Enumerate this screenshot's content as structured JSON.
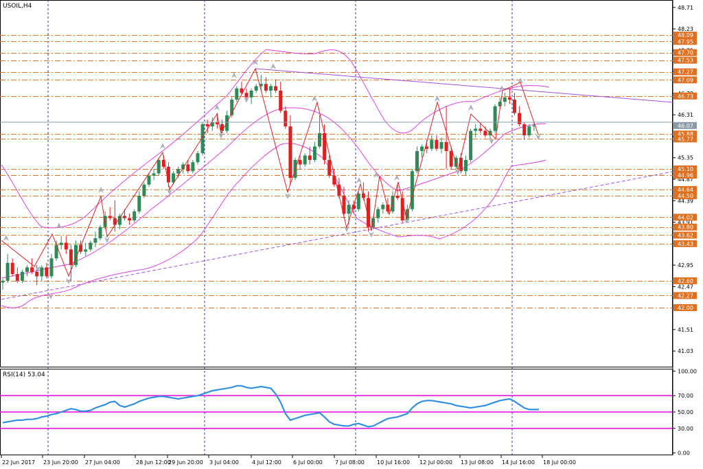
{
  "header": {
    "symbol_title": "USOIL,H4"
  },
  "rsi_panel": {
    "title": "RSI(14) 53.04",
    "levels": [
      30,
      50,
      70
    ]
  },
  "colors": {
    "bull": "#2e8b57",
    "bear": "#e02020",
    "bands": "#e040e0",
    "levels": "#e07020",
    "trend": "#a050e0",
    "zigzag": "#e02020",
    "rsi": "#2f8fe0",
    "rsi_levels": "#e000e0",
    "separator": "#3030c0"
  },
  "chart_data": {
    "type": "candlestick",
    "instrument": "USOIL",
    "timeframe": "H4",
    "price_axis": {
      "ticks": [
        "48.71",
        "48.23",
        "47.75",
        "47.27",
        "46.79",
        "46.31",
        "45.83",
        "45.35",
        "44.87",
        "44.39",
        "43.91",
        "43.43",
        "42.95",
        "42.47",
        "41.99",
        "41.51",
        "41.03"
      ],
      "ylim": [
        40.68,
        48.86
      ]
    },
    "time_axis": {
      "labels": [
        "22 Jun 2017",
        "23 Jun 20:00",
        "27 Jun 04:00",
        "28 Jun 12:00",
        "29 Jun 20:00",
        "3 Jul 04:00",
        "4 Jul 12:00",
        "6 Jul 00:00",
        "7 Jul 08:00",
        "10 Jul 16:00",
        "12 Jul 00:00",
        "13 Jul 08:00",
        "14 Jul 16:00",
        "18 Jul 00:00"
      ]
    },
    "current_price": 46.07,
    "horizontal_levels": [
      "48.09",
      "47.95",
      "47.70",
      "47.53",
      "47.27",
      "47.09",
      "46.73",
      "45.88",
      "45.77",
      "45.10",
      "44.96",
      "44.64",
      "44.50",
      "44.02",
      "43.80",
      "43.62",
      "43.43",
      "42.60",
      "42.27",
      "42.00"
    ],
    "candles": [
      [
        42.56,
        42.64,
        42.4,
        42.6
      ],
      [
        42.6,
        43.2,
        42.55,
        43.0
      ],
      [
        43.0,
        43.1,
        42.7,
        42.75
      ],
      [
        42.75,
        42.9,
        42.55,
        42.6
      ],
      [
        42.6,
        42.85,
        42.55,
        42.8
      ],
      [
        42.8,
        42.95,
        42.7,
        42.9
      ],
      [
        42.9,
        43.1,
        42.75,
        42.8
      ],
      [
        42.8,
        42.95,
        42.5,
        42.7
      ],
      [
        42.7,
        42.95,
        42.6,
        42.9
      ],
      [
        42.9,
        43.0,
        42.65,
        42.7
      ],
      [
        42.7,
        43.2,
        42.65,
        43.1
      ],
      [
        43.1,
        43.5,
        43.05,
        43.4
      ],
      [
        43.4,
        43.6,
        43.3,
        43.45
      ],
      [
        43.45,
        43.6,
        43.2,
        43.3
      ],
      [
        43.3,
        43.4,
        42.6,
        42.95
      ],
      [
        42.95,
        43.5,
        42.9,
        43.4
      ],
      [
        43.4,
        43.5,
        43.2,
        43.25
      ],
      [
        43.25,
        43.45,
        43.15,
        43.3
      ],
      [
        43.3,
        43.5,
        43.25,
        43.45
      ],
      [
        43.45,
        43.7,
        43.35,
        43.55
      ],
      [
        43.55,
        43.85,
        43.5,
        43.8
      ],
      [
        43.8,
        44.15,
        43.75,
        44.05
      ],
      [
        44.05,
        44.25,
        43.95,
        44.0
      ],
      [
        44.0,
        44.4,
        43.7,
        43.85
      ],
      [
        43.85,
        44.1,
        43.75,
        44.05
      ],
      [
        44.05,
        44.2,
        43.95,
        44.0
      ],
      [
        44.0,
        44.1,
        43.85,
        43.95
      ],
      [
        43.95,
        44.2,
        43.9,
        44.15
      ],
      [
        44.15,
        44.6,
        44.1,
        44.5
      ],
      [
        44.5,
        44.8,
        44.45,
        44.75
      ],
      [
        44.75,
        45.0,
        44.7,
        44.95
      ],
      [
        44.95,
        45.1,
        44.85,
        45.0
      ],
      [
        45.0,
        45.35,
        44.95,
        45.3
      ],
      [
        45.3,
        45.4,
        45.1,
        45.15
      ],
      [
        45.15,
        45.25,
        44.7,
        44.8
      ],
      [
        44.8,
        45.05,
        44.75,
        45.0
      ],
      [
        45.0,
        45.15,
        44.9,
        45.1
      ],
      [
        45.1,
        45.25,
        45.0,
        45.2
      ],
      [
        45.2,
        45.3,
        45.0,
        45.05
      ],
      [
        45.05,
        45.3,
        45.0,
        45.25
      ],
      [
        45.25,
        45.5,
        45.2,
        45.45
      ],
      [
        45.45,
        46.15,
        45.4,
        46.1
      ],
      [
        46.1,
        46.2,
        45.9,
        46.05
      ],
      [
        46.05,
        46.25,
        45.95,
        46.15
      ],
      [
        46.15,
        46.35,
        46.0,
        46.1
      ],
      [
        46.1,
        46.2,
        45.9,
        45.95
      ],
      [
        45.95,
        46.4,
        45.9,
        46.3
      ],
      [
        46.3,
        46.7,
        46.25,
        46.65
      ],
      [
        46.65,
        46.95,
        46.6,
        46.9
      ],
      [
        46.9,
        47.05,
        46.75,
        46.8
      ],
      [
        46.8,
        46.9,
        46.6,
        46.7
      ],
      [
        46.7,
        46.9,
        46.55,
        46.85
      ],
      [
        46.85,
        47.0,
        46.8,
        46.95
      ],
      [
        46.95,
        47.2,
        46.85,
        47.0
      ],
      [
        47.0,
        47.15,
        46.8,
        46.85
      ],
      [
        46.85,
        47.0,
        46.7,
        46.95
      ],
      [
        46.95,
        47.1,
        46.8,
        46.85
      ],
      [
        46.85,
        47.05,
        46.35,
        46.4
      ],
      [
        46.4,
        46.5,
        46.0,
        46.05
      ],
      [
        46.05,
        46.3,
        44.75,
        44.9
      ],
      [
        44.9,
        45.35,
        44.85,
        45.3
      ],
      [
        45.3,
        45.4,
        45.1,
        45.2
      ],
      [
        45.2,
        45.45,
        45.15,
        45.4
      ],
      [
        45.4,
        45.6,
        45.2,
        45.3
      ],
      [
        45.3,
        45.7,
        45.25,
        45.6
      ],
      [
        45.6,
        46.3,
        45.55,
        45.9
      ],
      [
        45.9,
        46.1,
        45.2,
        45.3
      ],
      [
        45.3,
        45.4,
        44.9,
        44.95
      ],
      [
        44.95,
        45.1,
        44.7,
        44.75
      ],
      [
        44.75,
        44.9,
        44.45,
        44.5
      ],
      [
        44.5,
        44.7,
        44.0,
        44.1
      ],
      [
        44.1,
        44.4,
        43.85,
        44.3
      ],
      [
        44.3,
        44.4,
        44.1,
        44.2
      ],
      [
        44.2,
        44.6,
        44.15,
        44.55
      ],
      [
        44.55,
        44.8,
        44.4,
        44.45
      ],
      [
        44.45,
        44.6,
        43.7,
        43.8
      ],
      [
        43.8,
        44.05,
        43.75,
        44.0
      ],
      [
        44.0,
        44.25,
        43.9,
        44.2
      ],
      [
        44.2,
        44.35,
        44.1,
        44.3
      ],
      [
        44.3,
        44.45,
        44.1,
        44.15
      ],
      [
        44.15,
        44.6,
        44.1,
        44.5
      ],
      [
        44.5,
        44.75,
        44.4,
        44.45
      ],
      [
        44.45,
        44.6,
        43.9,
        43.95
      ],
      [
        43.95,
        44.3,
        43.9,
        44.2
      ],
      [
        44.2,
        45.1,
        44.15,
        45.05
      ],
      [
        45.05,
        45.6,
        45.0,
        45.5
      ],
      [
        45.5,
        45.65,
        45.35,
        45.6
      ],
      [
        45.6,
        45.75,
        45.45,
        45.55
      ],
      [
        45.55,
        45.85,
        45.5,
        45.75
      ],
      [
        45.75,
        45.85,
        45.5,
        45.55
      ],
      [
        45.55,
        45.8,
        45.45,
        45.7
      ],
      [
        45.7,
        46.5,
        45.1,
        45.5
      ],
      [
        45.5,
        45.6,
        45.1,
        45.15
      ],
      [
        45.15,
        45.4,
        45.05,
        45.35
      ],
      [
        45.35,
        45.45,
        45.0,
        45.05
      ],
      [
        45.05,
        45.4,
        44.95,
        45.3
      ],
      [
        45.3,
        46.0,
        45.25,
        45.95
      ],
      [
        45.95,
        46.1,
        45.8,
        46.0
      ],
      [
        46.0,
        46.15,
        45.9,
        45.95
      ],
      [
        45.95,
        46.05,
        45.8,
        45.85
      ],
      [
        45.85,
        46.0,
        45.75,
        45.95
      ],
      [
        45.95,
        46.55,
        45.9,
        46.5
      ],
      [
        46.5,
        46.7,
        46.45,
        46.6
      ],
      [
        46.6,
        46.8,
        46.5,
        46.7
      ],
      [
        46.7,
        46.9,
        46.55,
        46.65
      ],
      [
        46.65,
        46.8,
        46.3,
        46.35
      ],
      [
        46.35,
        46.5,
        46.05,
        46.1
      ],
      [
        46.1,
        46.15,
        45.75,
        45.85
      ],
      [
        45.85,
        46.1,
        45.8,
        46.05
      ],
      [
        46.05,
        46.15,
        45.95,
        46.07
      ]
    ],
    "rsi": {
      "value": 53.04,
      "ylim": [
        -2,
        102
      ],
      "ticks": [
        "100.00",
        "70.00",
        "50.00",
        "30.00",
        "0.00"
      ],
      "values": [
        37,
        38,
        39,
        40,
        40,
        41,
        41,
        42,
        44,
        45,
        47,
        48,
        50,
        52,
        54,
        53,
        51,
        51,
        52,
        55,
        57,
        59,
        62,
        63,
        58,
        56,
        58,
        60,
        63,
        65,
        67,
        68,
        69,
        69,
        68,
        67,
        66,
        67,
        68,
        69,
        70,
        72,
        74,
        76,
        77,
        78,
        79,
        80,
        82,
        82,
        80,
        79,
        80,
        81,
        80,
        79,
        72,
        62,
        48,
        40,
        42,
        44,
        46,
        47,
        48,
        49,
        44,
        38,
        35,
        34,
        33,
        33,
        35,
        36,
        34,
        32,
        33,
        36,
        39,
        42,
        43,
        44,
        46,
        48,
        55,
        60,
        63,
        64,
        64,
        63,
        62,
        61,
        60,
        58,
        57,
        56,
        55,
        56,
        57,
        58,
        60,
        62,
        64,
        65,
        66,
        63,
        59,
        55,
        53,
        53,
        53
      ]
    }
  }
}
